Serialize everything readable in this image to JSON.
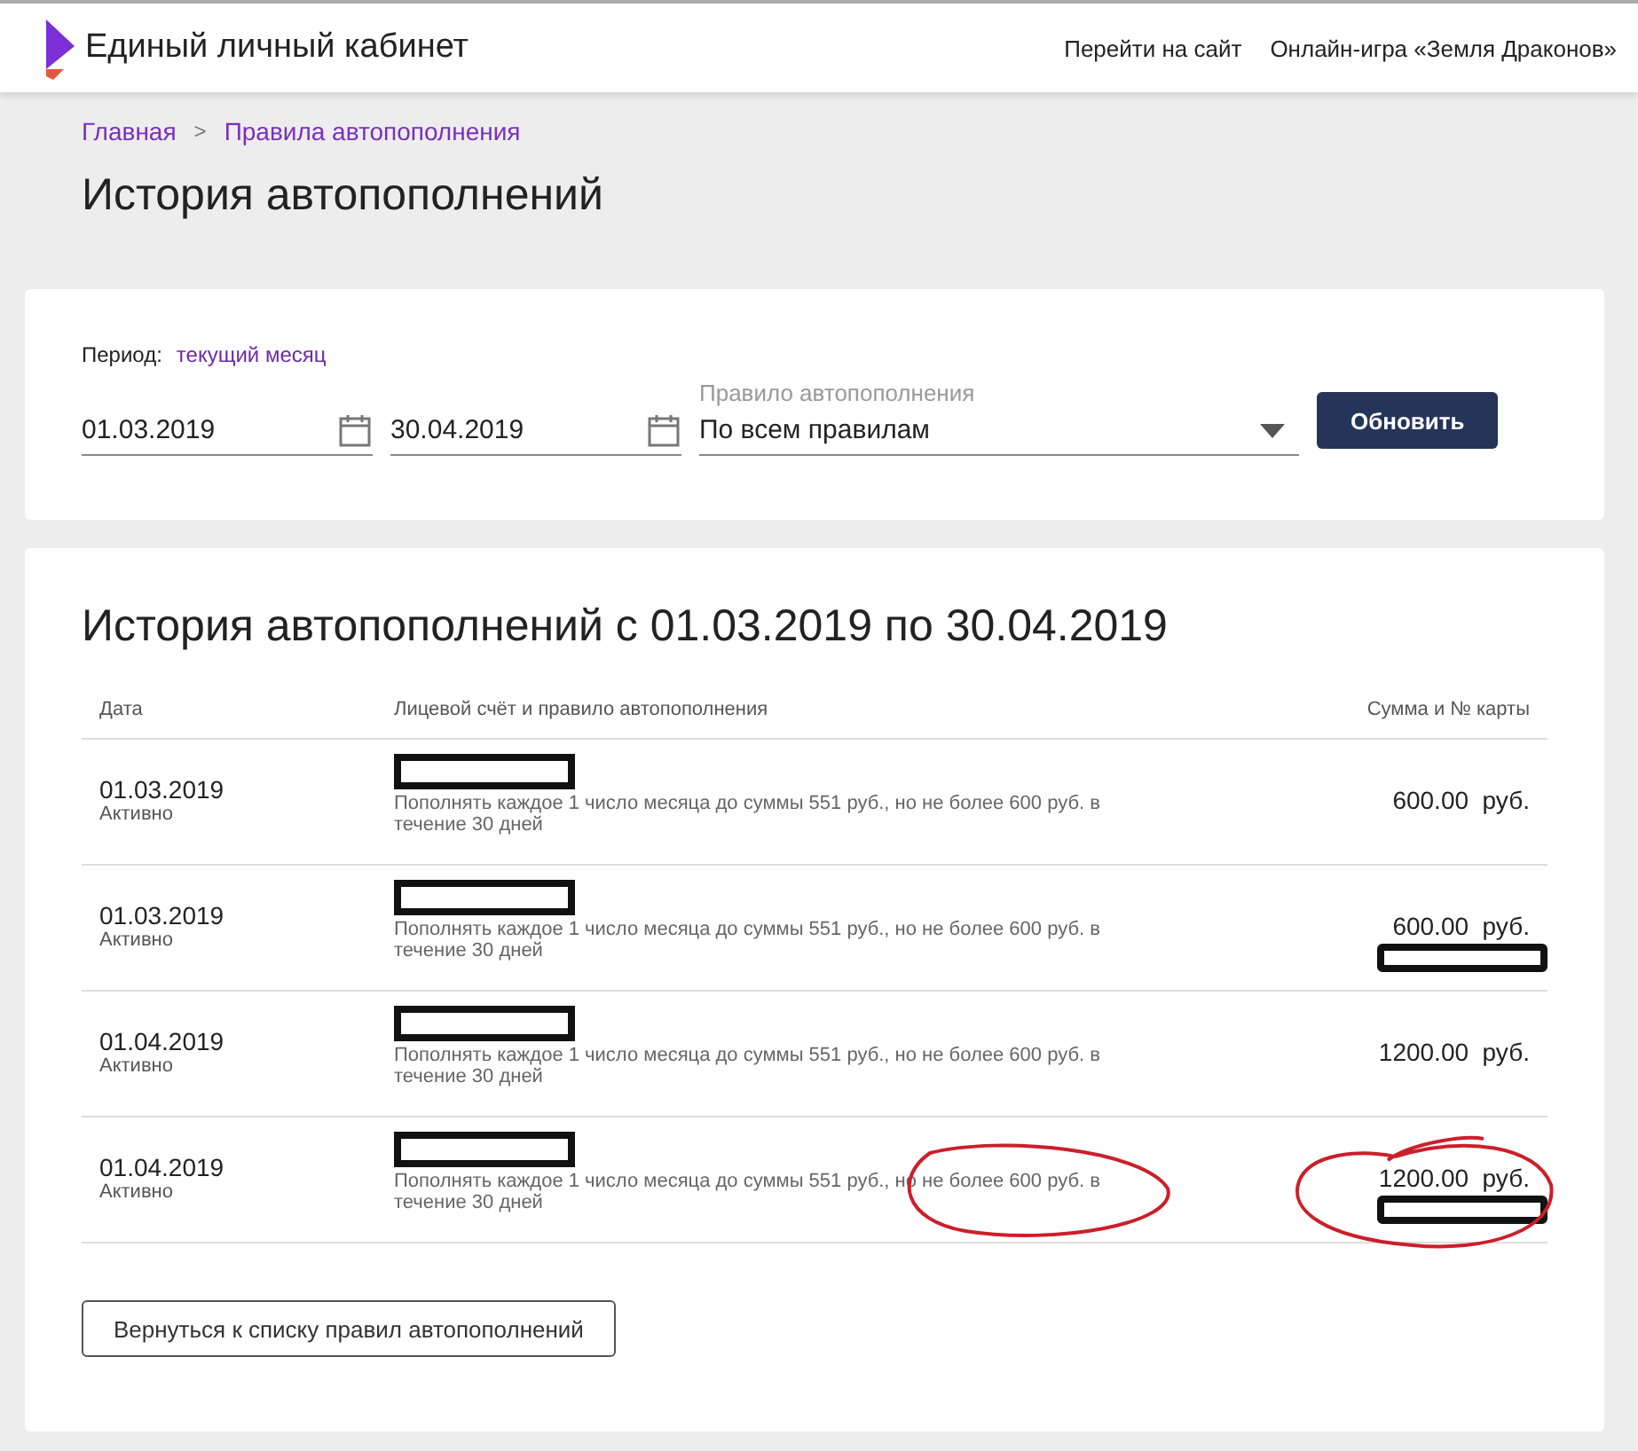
{
  "header": {
    "title": "Единый личный кабинет",
    "links": [
      "Перейти на сайт",
      "Онлайн-игра «Земля Драконов»"
    ]
  },
  "breadcrumbs": [
    "Главная",
    ">",
    "Правила автопополнения"
  ],
  "page_title": "История автопополнений",
  "filter": {
    "period_label": "Период:",
    "period_link": "текущий месяц",
    "date_from": "01.03.2019",
    "date_to": "30.04.2019",
    "rule_label": "Правило автопополнения",
    "rule_value": "По всем правилам",
    "button": "Обновить"
  },
  "history": {
    "title": "История автопополнений с 01.03.2019 по 30.04.2019",
    "columns": [
      "Дата",
      "Лицевой счёт и правило автопополнения",
      "Сумма и № карты"
    ],
    "rows": [
      {
        "date": "01.03.2019",
        "status": "Активно",
        "rule": "Пополнять каждое 1 число месяца до суммы 551 руб., но не более 600 руб. в течение 30 дней",
        "amount": "600.00",
        "currency": "руб.",
        "card_redacted": false,
        "circled": false
      },
      {
        "date": "01.03.2019",
        "status": "Активно",
        "rule": "Пополнять каждое 1 число месяца до суммы 551 руб., но не более 600 руб. в течение 30 дней",
        "amount": "600.00",
        "currency": "руб.",
        "card_redacted": true,
        "circled": false
      },
      {
        "date": "01.04.2019",
        "status": "Активно",
        "rule": "Пополнять каждое 1 число месяца до суммы 551 руб., но не более 600 руб. в течение 30 дней",
        "amount": "1200.00",
        "currency": "руб.",
        "card_redacted": false,
        "circled": false
      },
      {
        "date": "01.04.2019",
        "status": "Активно",
        "rule": "Пополнять каждое 1 число месяца до суммы 551 руб., но не более 600 руб. в течение 30 дней",
        "amount": "1200.00",
        "currency": "руб.",
        "card_redacted": true,
        "circled": true
      }
    ],
    "back_button": "Вернуться к списку правил автопополнений"
  }
}
